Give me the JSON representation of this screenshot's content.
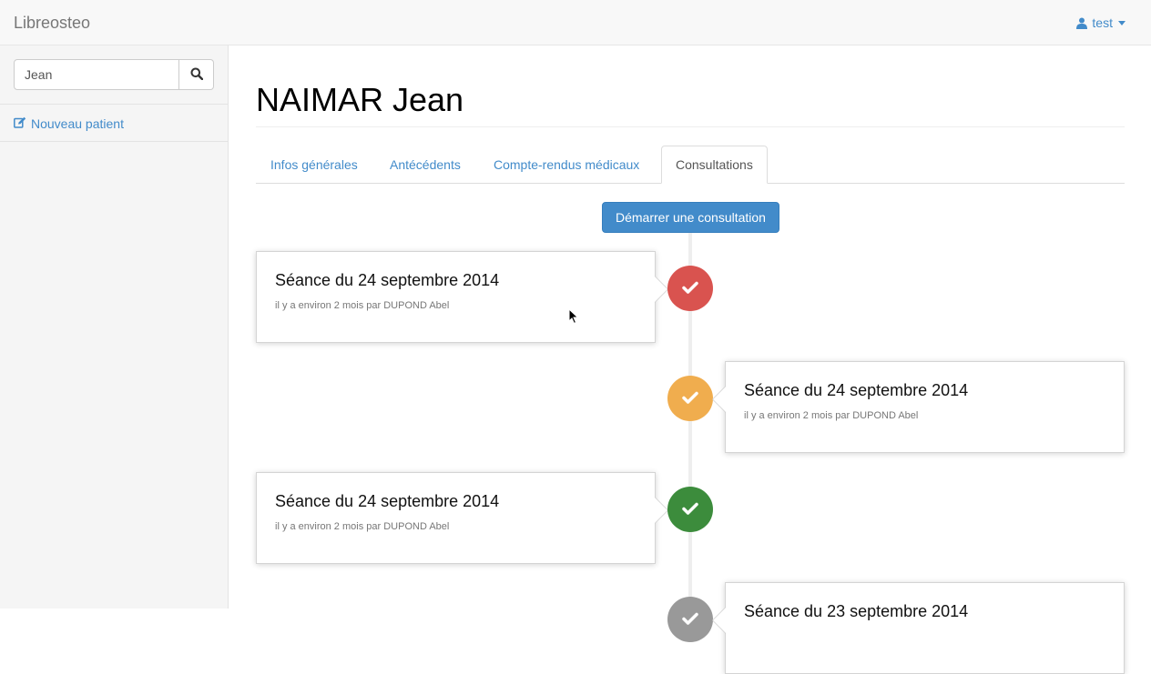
{
  "navbar": {
    "brand": "Libreosteo",
    "user": "test"
  },
  "sidebar": {
    "search": {
      "value": "Jean",
      "icon": "search-icon"
    },
    "new_patient": "Nouveau patient"
  },
  "patient": {
    "name": "NAIMAR Jean"
  },
  "tabs": [
    {
      "label": "Infos générales",
      "active": false
    },
    {
      "label": "Antécédents",
      "active": false
    },
    {
      "label": "Compte-rendus médicaux",
      "active": false
    },
    {
      "label": "Consultations",
      "active": true
    }
  ],
  "start_button": "Démarrer une consultation",
  "timeline": [
    {
      "title": "Séance du 24 septembre 2014",
      "meta": "il y a environ 2 mois par DUPOND Abel",
      "side": "left",
      "color": "#d9534f",
      "icon": "check-icon"
    },
    {
      "title": "Séance du 24 septembre 2014",
      "meta": "il y a environ 2 mois par DUPOND Abel",
      "side": "right",
      "color": "#f0ad4e",
      "icon": "check-icon"
    },
    {
      "title": "Séance du 24 septembre 2014",
      "meta": "il y a environ 2 mois par DUPOND Abel",
      "side": "left",
      "color": "#3c8c3c",
      "icon": "check-icon"
    },
    {
      "title": "Séance du 23 septembre 2014",
      "meta": "",
      "side": "right",
      "color": "#999999",
      "icon": "check-icon"
    }
  ]
}
